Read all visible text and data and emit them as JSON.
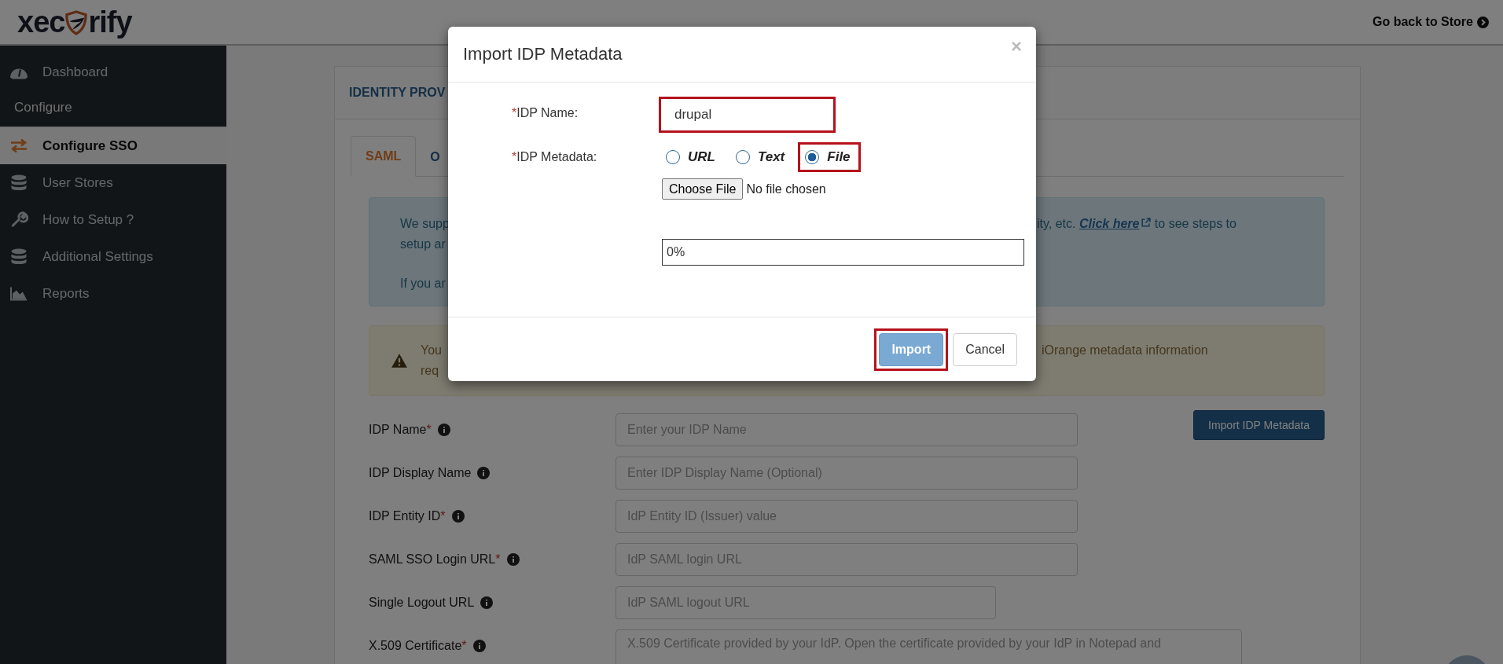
{
  "header": {
    "logo": {
      "text_before": "xec",
      "text_after": "rify"
    },
    "store_link": "Go back to Store"
  },
  "sidebar": {
    "items": [
      {
        "kind": "gauge",
        "label": "Dashboard",
        "selected": false
      },
      {
        "kind": "heading",
        "label": "Configure"
      },
      {
        "kind": "swap",
        "label": "Configure SSO",
        "selected": true
      },
      {
        "kind": "database",
        "label": "User Stores",
        "selected": false
      },
      {
        "kind": "wrench",
        "label": "How to Setup ?",
        "selected": false
      },
      {
        "kind": "database",
        "label": "Additional Settings",
        "selected": false
      },
      {
        "kind": "chart",
        "label": "Reports",
        "selected": false
      }
    ]
  },
  "card": {
    "title": "IDENTITY PROV",
    "tabs": [
      {
        "label": "SAML",
        "selected": true
      },
      {
        "label": "O",
        "selected": false
      }
    ],
    "info": {
      "lines": [
        {
          "left": "We supp",
          "right": "ity, etc. ",
          "link": "Click here",
          "after": " to see steps to"
        },
        {
          "left": "setup ar"
        },
        {
          "left": "If you ar"
        }
      ]
    },
    "warning": {
      "lines": [
        {
          "left": "You",
          "right": "iOrange metadata information"
        },
        {
          "left": "req"
        }
      ]
    },
    "import_button": "Import IDP Metadata",
    "fields": [
      {
        "kind": "input",
        "label": "IDP Name",
        "marker": "*",
        "placeholder": "Enter your IDP Name"
      },
      {
        "kind": "input",
        "label": "IDP Display Name",
        "placeholder": "Enter IDP Display Name (Optional)"
      },
      {
        "kind": "input",
        "label": "IDP Entity ID",
        "marker": "*",
        "placeholder": "IdP Entity ID (Issuer) value"
      },
      {
        "kind": "input",
        "label": "SAML SSO Login URL",
        "marker": "*",
        "placeholder": "IdP SAML login URL"
      },
      {
        "kind": "short",
        "label": "Single Logout URL",
        "placeholder": "IdP SAML logout URL"
      },
      {
        "kind": "textarea",
        "label": "X.509 Certificate",
        "marker": "*",
        "placeholder": "X.509 Certificate provided by your IdP. Open the certificate provided by your IdP in Notepad and"
      }
    ]
  },
  "modal": {
    "title": "Import IDP Metadata",
    "close": "×",
    "name_field": {
      "marker": "*",
      "label": "IDP Name:",
      "value": "drupal",
      "highlighted": true
    },
    "metadata": {
      "marker": "*",
      "label": "IDP Metadata:",
      "options": [
        {
          "label": "URL",
          "selected": false,
          "highlighted": false
        },
        {
          "label": "Text",
          "selected": false,
          "highlighted": false
        },
        {
          "label": "File",
          "selected": true,
          "highlighted": true
        }
      ]
    },
    "file_button": "Choose File",
    "file_status": "No file chosen",
    "progress": "0%",
    "buttons": [
      {
        "label": "Import",
        "kind": "primary",
        "highlighted": true
      },
      {
        "label": "Cancel",
        "kind": "default",
        "highlighted": false
      }
    ]
  }
}
